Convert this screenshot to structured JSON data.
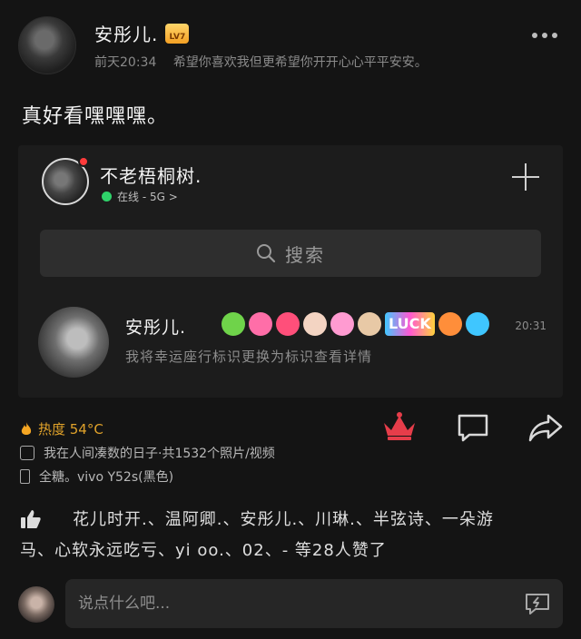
{
  "post": {
    "author": "安彤儿.",
    "level": "LV7",
    "timestamp": "前天20:34",
    "signature": "希望你喜欢我但更希望你开开心心平平安安。",
    "text": "真好看嘿嘿嘿。"
  },
  "screenshot": {
    "contact_name": "不老梧桐树.",
    "status": "在线 - 5G >",
    "search_placeholder": "搜索",
    "chat": {
      "name": "安彤儿.",
      "icons": [
        "dumbbell",
        "flower",
        "heart",
        "girl",
        "flower-pink",
        "boy"
      ],
      "luck_label": "LUCK",
      "time": "20:31",
      "preview": "我将幸运座行标识更换为标识查看详情"
    }
  },
  "stats": {
    "heat": "热度 54°C",
    "album": "我在人间凑数的日子·共1532个照片/视频",
    "device": "全糖。vivo Y52s(黑色)"
  },
  "likes": {
    "line1": "花儿时开.、温阿卿.、安彤儿.、川琳.、半弦诗、一朵游",
    "line2": "马、心软永远吃亏、yi oo.、02、- 等28人赞了"
  },
  "comment": {
    "placeholder": "说点什么吧..."
  },
  "colors": {
    "background": "#141414",
    "heat": "#e0a22a",
    "online": "#2fd36a",
    "gift": "#e63d4a"
  }
}
